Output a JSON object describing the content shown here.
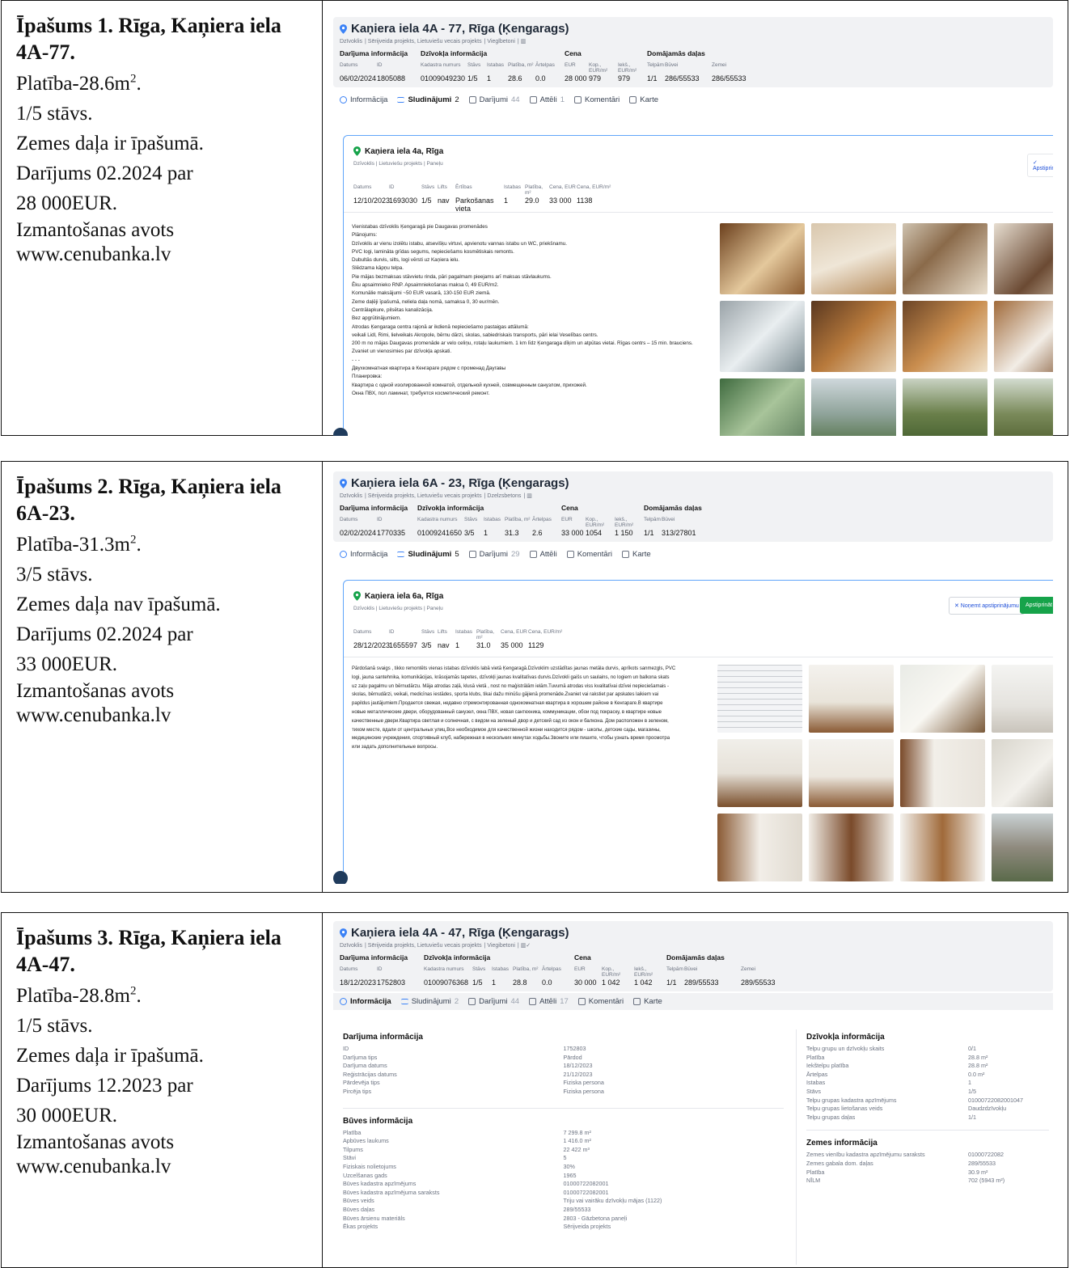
{
  "rows": [
    {
      "head": "Īpašums 1. Rīga, Kaņiera iela 4A-77.",
      "area_prefix": "Platība-28.6m",
      "area_sup": "2",
      "area_suffix": ".",
      "floor": "1/5 stāvs.",
      "land": "Zemes daļa ir īpašumā.",
      "deal1": "Darījums 02.2024 par",
      "deal2": "28 000EUR.",
      "src1": "Izmantošanas avots",
      "src2": "www.cenubanka.lv",
      "shot": {
        "title": "Kaņiera iela 4A - 77, Rīga (Ķengarags)",
        "tags": [
          "Dzīvoklis",
          "Sērijveida projekts, Lietuviešu vecais projekts",
          "Vieglbetoni",
          "▥"
        ],
        "sections": [
          "Darījuma informācija",
          "Dzīvokļa informācija",
          "Cena",
          "Domājamās daļas"
        ],
        "labels": [
          "Datums",
          "ID",
          "Kadastra numurs",
          "Stāvs",
          "Istabas",
          "Platība, m²",
          "Ārtelpas",
          "EUR",
          "Kop., EUR/m²",
          "Iekš., EUR/m²",
          "Telpām",
          "Būvei",
          "Zemei"
        ],
        "values": [
          "06/02/2024",
          "1805088",
          "01009049230",
          "1/5",
          "1",
          "28.6",
          "0.0",
          "28 000",
          "979",
          "979",
          "1/1",
          "286/55533",
          "286/55533"
        ],
        "tabs": [
          {
            "label": "Informācija",
            "count": ""
          },
          {
            "label": "Sludinājumi",
            "count": "2"
          },
          {
            "label": "Darījumi",
            "count": "44"
          },
          {
            "label": "Attēli",
            "count": "1"
          },
          {
            "label": "Komentāri",
            "count": ""
          },
          {
            "label": "Karte",
            "count": ""
          }
        ],
        "card": {
          "title": "Kaņiera iela 4a, Rīga",
          "tags": [
            "Dzīvoklis",
            "Lietuviešu projekts",
            "Paneļu"
          ],
          "labels": [
            "Datums",
            "ID",
            "Stāvs",
            "Lifts",
            "Ērtības",
            "Istabas",
            "Platība, m²",
            "Cena, EUR",
            "Cena, EUR/m²"
          ],
          "values": [
            "12/10/2023",
            "1693030",
            "1/5",
            "nav",
            "Parkošanas vieta",
            "1",
            "29.0",
            "33 000",
            "1138"
          ],
          "buttons": [
            "✓ Apstiprināt"
          ],
          "desc": "Vienistabas dzīvoklis Ķengaragā pie Daugavas promenādes\nPlānojums:\nDzīvoklis ar vienu izolētu istabu, atsevišķu virtuvi, apvienotu vannas istabu un WC, priekšnamu.\nPVC logi, lamināta grīdas segums, nepieciešams kosmētiskais remonts.\nDubultās durvis, silts, logi vērsti uz Kaņiera ielu.\nSlēdzama kāpņu telpa.\nPie mājas bezmaksas stāvvietu rinda, pāri pagalmam pieejams arī maksas stāvlaukums.\nĒku apsaimnieko RNP. Apsaimniekošanas maksa 0, 49 EUR/m2.\nKomunālie maksājumi ~50 EUR vasarā, 130-150 EUR ziemā.\nZeme daļēji īpašumā, neliela daļa nomā, samaksa 0, 30 eur/mēn.\nCentrālapkure, pilsētas kanalizācija.\nBez apgrūtinājumiem.\nAtrodas Ķengaraga centra rajonā ar ikdienā nepieciešamo pastaigas attālumā:\nveikali Lidl, Rimi, lielveikals Akropole, bērnu dārzi, skolas, sabiedriskais transports, pāri ielai Veselības centrs.\n200 m no mājas Daugavas promenāde ar velo celiņu, rotaļu laukumiem. 1 km līdz Ķengaraga dīķim un atpūtas vietai. Rīgas centrs – 15 min. brauciens.\nZvaniet un vienosimies par dzīvokļa apskati.\n- - -\nДвухкомнатная квартира в Кенгараге рядом с променад Даугавы\nПланировка:\nКвартира с одной изолированной комнатой, отдельной кухней, совмещенным санузлом, прихожей.\nОкна ПВХ, пол ламинат, требуется косметический ремонт."
        }
      }
    },
    {
      "head": "Īpašums 2. Rīga, Kaņiera iela 6A-23.",
      "area_prefix": "Platība-31.3m",
      "area_sup": "2",
      "area_suffix": ".",
      "floor": "3/5 stāvs.",
      "land": "Zemes daļa nav īpašumā.",
      "deal1": "Darījums 02.2024 par",
      "deal2": "33 000EUR.",
      "src1": "Izmantošanas avots",
      "src2": "www.cenubanka.lv",
      "shot": {
        "title": "Kaņiera iela 6A - 23, Rīga (Ķengarags)",
        "tags": [
          "Dzīvoklis",
          "Sērijveida projekts, Lietuviešu vecais projekts",
          "Dzelzsbetons",
          "▥"
        ],
        "sections": [
          "Darījuma informācija",
          "Dzīvokļa informācija",
          "Cena",
          "Domājamās daļas"
        ],
        "labels": [
          "Datums",
          "ID",
          "Kadastra numurs",
          "Stāvs",
          "Istabas",
          "Platība, m²",
          "Ārtelpas",
          "EUR",
          "Kop., EUR/m²",
          "Iekš., EUR/m²",
          "Telpām",
          "Būvei",
          ""
        ],
        "values": [
          "02/02/2024",
          "1770335",
          "01009241650",
          "3/5",
          "1",
          "31.3",
          "2.6",
          "33 000",
          "1054",
          "1 150",
          "1/1",
          "313/27801",
          ""
        ],
        "tabs": [
          {
            "label": "Informācija",
            "count": ""
          },
          {
            "label": "Sludinājumi",
            "count": "5"
          },
          {
            "label": "Darījumi",
            "count": "29"
          },
          {
            "label": "Attēli",
            "count": ""
          },
          {
            "label": "Komentāri",
            "count": ""
          },
          {
            "label": "Karte",
            "count": ""
          }
        ],
        "card": {
          "title": "Kaņiera iela 6a, Rīga",
          "tags": [
            "Dzīvoklis",
            "Lietuviešu projekts",
            "Paneļu"
          ],
          "labels": [
            "Datums",
            "ID",
            "Stāvs",
            "Lifts",
            "Istabas",
            "Platība, m²",
            "Cena, EUR",
            "Cena, EUR/m²",
            ""
          ],
          "values": [
            "28/12/2023",
            "1655597",
            "3/5",
            "nav",
            "1",
            "31.0",
            "35 000",
            "1129",
            ""
          ],
          "buttons": [
            "✕ Noņemt apstiprinājumu",
            "Apstiprināt"
          ],
          "desc": "Pārdošanā svaigs , tikko remontēts vienas istabas dzīvoklis labā vietā Ķengaragā.Dzīvoklim uzstādītas jaunas metāla durvis, aprīkots sanmezgls, PVC\nlogi, jauna santehnika, komunikācijas, krāsojamās tapetes, dzīvokļi jaunas kvalitatīvas durvis.Dzīvokli gaišs un saulains, no logiem un balkona skats\nuz zaļu pagalmu un bērnudārzu. Māja atrodas zaļā, klusā vietā , nost no maģistrālām ielām.Tuvumā atrodas viss kvalitatīvai dzīvei nepieciešamais -\nskolas, bērnudārzi, veikali, medicīnas iestādes, sporta klubs, tikai dažu minūšu gājienā promenāde.Zvaniet vai rakstiet par apskates laikiem vai\npapildus jautājumiem.Продается свежая, недавно отремонтированная однокомнатная квартира в хорошем районе в Кенгараге.В квартире\nновые металлические двери, оборудованный санузел, окна ПВХ, новая сантехника, коммуникации, обои под покраску, в квартире новые\nкачественные двери.Квартира светлая и солнечная, с видом на зеленый двор и детский сад из окон и балкона. Дом расположен в зеленом,\nтихом месте, вдали от центральных улиц.Все необходимое для качественной жизни находится рядом - школы, детские сады, магазины,\nмедицинские учреждения, спортивный клуб, набережная в нескольких минутах ходьбы.Звоните или пишите, чтобы узнать время просмотра\nили задать дополнительные вопросы."
        }
      }
    },
    {
      "head": "Īpašums 3. Rīga, Kaņiera iela 4A-47.",
      "area_prefix": "Platība-28.8m",
      "area_sup": "2",
      "area_suffix": ".",
      "floor": "1/5 stāvs.",
      "land": "Zemes daļa ir īpašumā.",
      "deal1": "Darījums 12.2023 par",
      "deal2": "30 000EUR.",
      "src1": "Izmantošanas avots",
      "src2": "www.cenubanka.lv",
      "shot": {
        "title": "Kaņiera iela 4A - 47, Rīga (Ķengarags)",
        "tags": [
          "Dzīvoklis",
          "Sērijveida projekts, Lietuviešu vecais projekts",
          "Viegibetoni",
          "▥✓"
        ],
        "sections": [
          "Darījuma informācija",
          "Dzīvokļa informācija",
          "Cena",
          "Domājamās daļas"
        ],
        "labels": [
          "Datums",
          "ID",
          "Kadastra numurs",
          "Stāvs",
          "Istabas",
          "Platība, m²",
          "Ārtelpas",
          "EUR",
          "Kop., EUR/m²",
          "Iekš., EUR/m²",
          "Telpām",
          "Būvei",
          "Zemei"
        ],
        "values": [
          "18/12/2023",
          "1752803",
          "01009076368",
          "1/5",
          "1",
          "28.8",
          "0.0",
          "30 000",
          "1 042",
          "1 042",
          "1/1",
          "289/55533",
          "289/55533"
        ],
        "tabs": [
          {
            "label": "Informācija",
            "count": ""
          },
          {
            "label": "Sludinājumi",
            "count": "2"
          },
          {
            "label": "Darījumi",
            "count": "44"
          },
          {
            "label": "Attēli",
            "count": "17"
          },
          {
            "label": "Komentāri",
            "count": ""
          },
          {
            "label": "Karte",
            "count": ""
          }
        ],
        "deal_title": "Darījuma informācija",
        "deal_kv": [
          [
            "ID",
            "1752803"
          ],
          [
            "Darījuma tips",
            "Pārdod"
          ],
          [
            "Darījuma datums",
            "18/12/2023"
          ],
          [
            "Reģistrācijas datums",
            "21/12/2023"
          ],
          [
            "Pārdevēja tips",
            "Fiziska persona"
          ],
          [
            "Pircēja tips",
            "Fiziska persona"
          ]
        ],
        "build_title": "Būves informācija",
        "build_kv": [
          [
            "Platība",
            "7 299.8 m²"
          ],
          [
            "Apbūves laukums",
            "1 416.0 m²"
          ],
          [
            "Tilpums",
            "22 422 m³"
          ],
          [
            "Stāvi",
            "5"
          ],
          [
            "Fiziskais nolietojums",
            "30%"
          ],
          [
            "Uzcelšanas gads",
            "1965"
          ],
          [
            "Būves kadastra apzīmējums",
            "01000722082001"
          ],
          [
            "Būves kadastra apzīmējuma saraksts",
            "01000722082001"
          ],
          [
            "Būves veids",
            "Triju vai vairāku dzīvokļu mājas (1122)"
          ],
          [
            "Būves daļas",
            "289/55533"
          ],
          [
            "Būves ārsienu materiāls",
            "2803 - Gāzbetona paneļi"
          ],
          [
            "Ēkas projekts",
            "Sērijveida projekts"
          ]
        ],
        "apt_title": "Dzīvokļa informācija",
        "apt_kv": [
          [
            "Telpu grupu un dzīvokļu skaits",
            "0/1"
          ],
          [
            "Platība",
            "28.8 m²"
          ],
          [
            "Iekštelpu platība",
            "28.8 m²"
          ],
          [
            "Ārtelpas",
            "0.0 m²"
          ],
          [
            "Istabas",
            "1"
          ],
          [
            "Stāvs",
            "1/5"
          ],
          [
            "Telpu grupas kadastra apzīmējums",
            "01000722082001047"
          ],
          [
            "Telpu grupas lietošanas veids",
            "Daudzdzīvokļu"
          ],
          [
            "Telpu grupas daļas",
            "1/1"
          ]
        ],
        "land_title": "Zemes informācija",
        "land_kv": [
          [
            "Zemes vienību kadastra apzīmējumu saraksts",
            "01000722082"
          ],
          [
            "Zemes gabala dom. daļas",
            "289/55533"
          ],
          [
            "Platība",
            "30.9 m²"
          ],
          [
            "NĪLM",
            "702 (5943 m²)"
          ]
        ]
      }
    }
  ],
  "colors": {
    "accent": "#3b82f6",
    "green": "#16a34a",
    "pin": "#16a34a"
  },
  "icons": [
    "map-pin-icon",
    "info-icon",
    "list-icon",
    "calendar-icon",
    "image-icon",
    "comment-icon",
    "map-icon"
  ]
}
